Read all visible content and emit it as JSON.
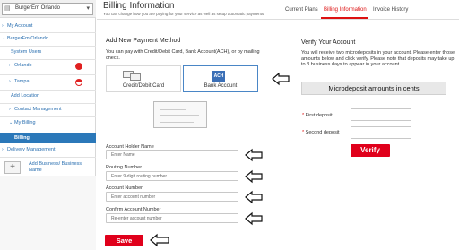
{
  "sidebar": {
    "search_value": "BurgerEm Orlando",
    "items": [
      {
        "label": "My Account",
        "chev": ">"
      },
      {
        "label": "BurgerEm Orlando",
        "chev": "v"
      },
      {
        "label": "System Users",
        "chev": ""
      },
      {
        "label": "Orlando",
        "chev": ">"
      },
      {
        "label": "Tampa",
        "chev": ">"
      },
      {
        "label": "Add Location",
        "chev": ""
      },
      {
        "label": "Contact Management",
        "chev": ">"
      },
      {
        "label": "My Billing",
        "chev": "v"
      }
    ],
    "active_item": "Billing",
    "delivery": "Delivery Management",
    "add_business": "Add Business/ Business Name"
  },
  "header": {
    "title": "Billing Information",
    "subtitle": "You can change how you are paying for your service as well as setup automatic payments",
    "tabs": [
      {
        "label": "Current Plans",
        "active": false
      },
      {
        "label": "Billing Information",
        "active": true
      },
      {
        "label": "Invoice History",
        "active": false
      }
    ]
  },
  "payment": {
    "title": "Add New Payment Method",
    "description": "You can pay with Credit/Debit Card, Bank Account(ACH), or by mailing check.",
    "options": [
      {
        "label": "Credit/Debit Card",
        "icon": "credit-card-icon"
      },
      {
        "label": "Bank Account",
        "icon": "ach-icon",
        "badge": "ACH"
      }
    ],
    "fields": [
      {
        "label": "Account Holder Name",
        "placeholder": "Enter Name"
      },
      {
        "label": "Routing Number",
        "placeholder": "Enter 9-digit routing number"
      },
      {
        "label": "Account Number",
        "placeholder": "Enter account number"
      },
      {
        "label": "Confirm Account Number",
        "placeholder": "Re-enter account number"
      }
    ],
    "save_label": "Save"
  },
  "verify": {
    "title": "Verify Your Account",
    "description": "You will receive two microdeposits in your account. Please enter those amounts below and click verify. Please note that deposits may take up to 3 business days to appear in your account.",
    "microdeposit_heading": "Microdeposit amounts in cents",
    "first_label": "First deposit",
    "second_label": "Second deposit",
    "required_mark": "*",
    "verify_label": "Verify"
  },
  "colors": {
    "accent": "#e0001b",
    "link": "#2a6fb0",
    "active_nav": "#2b78b9"
  }
}
